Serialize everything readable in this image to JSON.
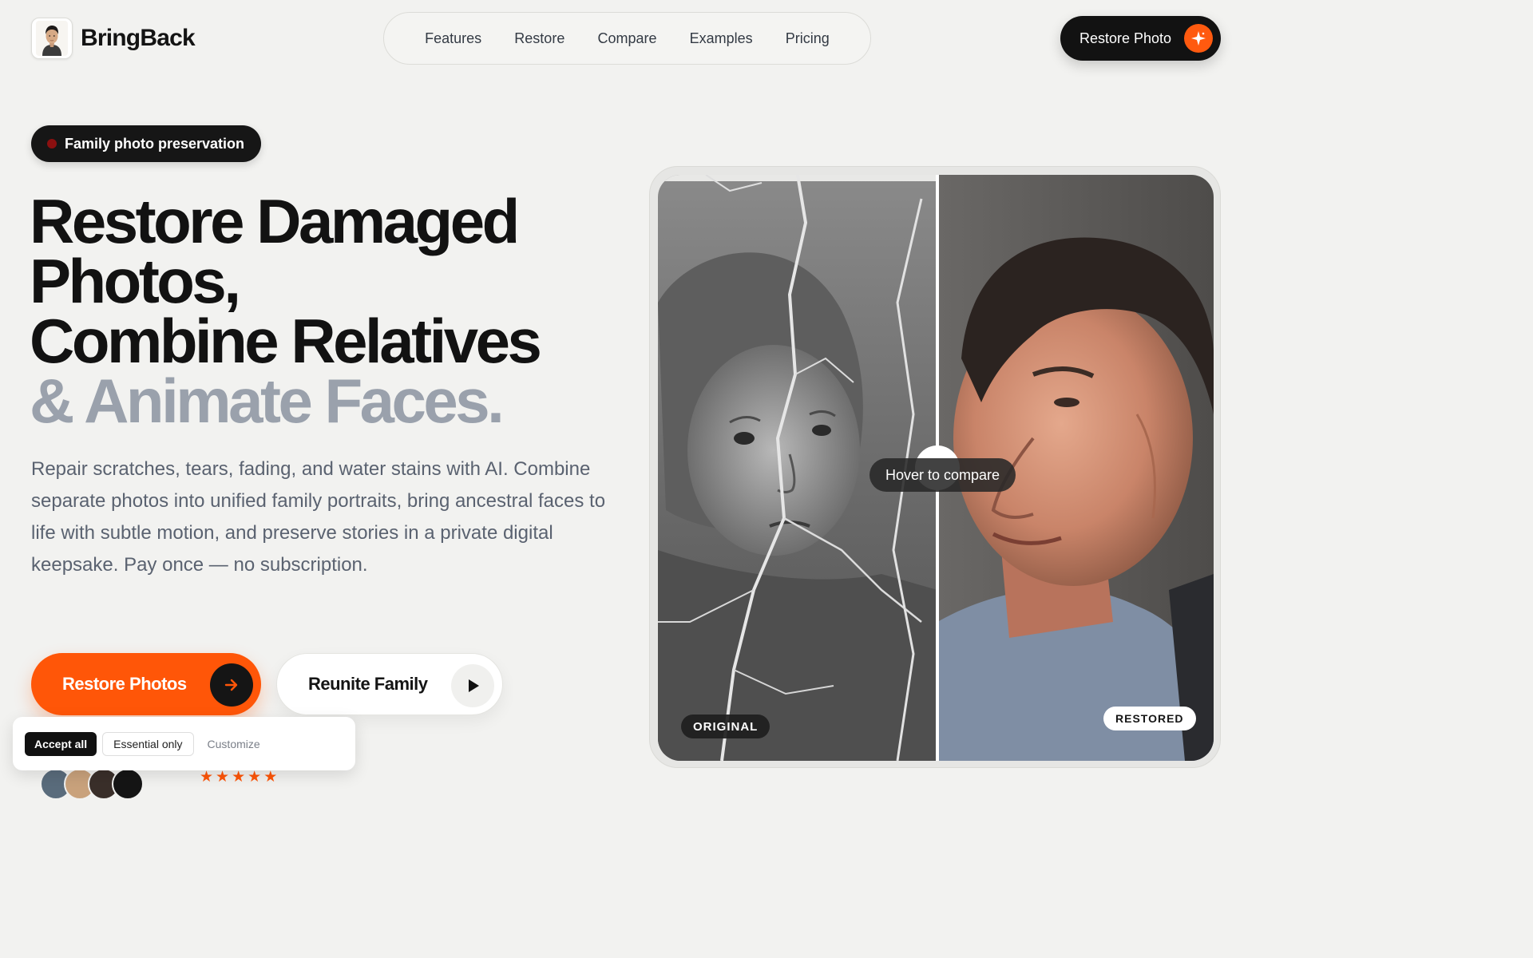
{
  "brand": {
    "name": "BringBack",
    "logo_icon": "portrait-logo-icon"
  },
  "nav": {
    "items": [
      "Features",
      "Restore",
      "Compare",
      "Examples",
      "Pricing"
    ]
  },
  "header_cta": {
    "label": "Restore Photo",
    "icon": "sparkle-icon",
    "accent": "#ff5608"
  },
  "hero": {
    "badge": "Family photo preservation",
    "headline": {
      "line1": "Restore Damaged",
      "line2": "Photos,",
      "line3": "Combine Relatives",
      "line4": "& Animate Faces."
    },
    "description": "Repair scratches, tears, fading, and water stains with AI. Combine separate photos into unified family portraits, bring ancestral faces to life with subtle motion, and preserve stories in a private digital keepsake. Pay once — no subscription.",
    "primary_button": {
      "label": "Restore Photos",
      "icon": "arrow-right-icon"
    },
    "secondary_button": {
      "label": "Reunite Family",
      "icon": "play-icon"
    }
  },
  "compare": {
    "hint": "Hover to compare",
    "original_label": "ORIGINAL",
    "restored_label": "RESTORED"
  },
  "cookie_banner": {
    "accept": "Accept all",
    "essential": "Essential only",
    "customize": "Customize"
  },
  "colors": {
    "accent": "#ff5608",
    "dark": "#121212",
    "muted_headline": "#9aa1ac",
    "background": "#f2f2f0"
  }
}
